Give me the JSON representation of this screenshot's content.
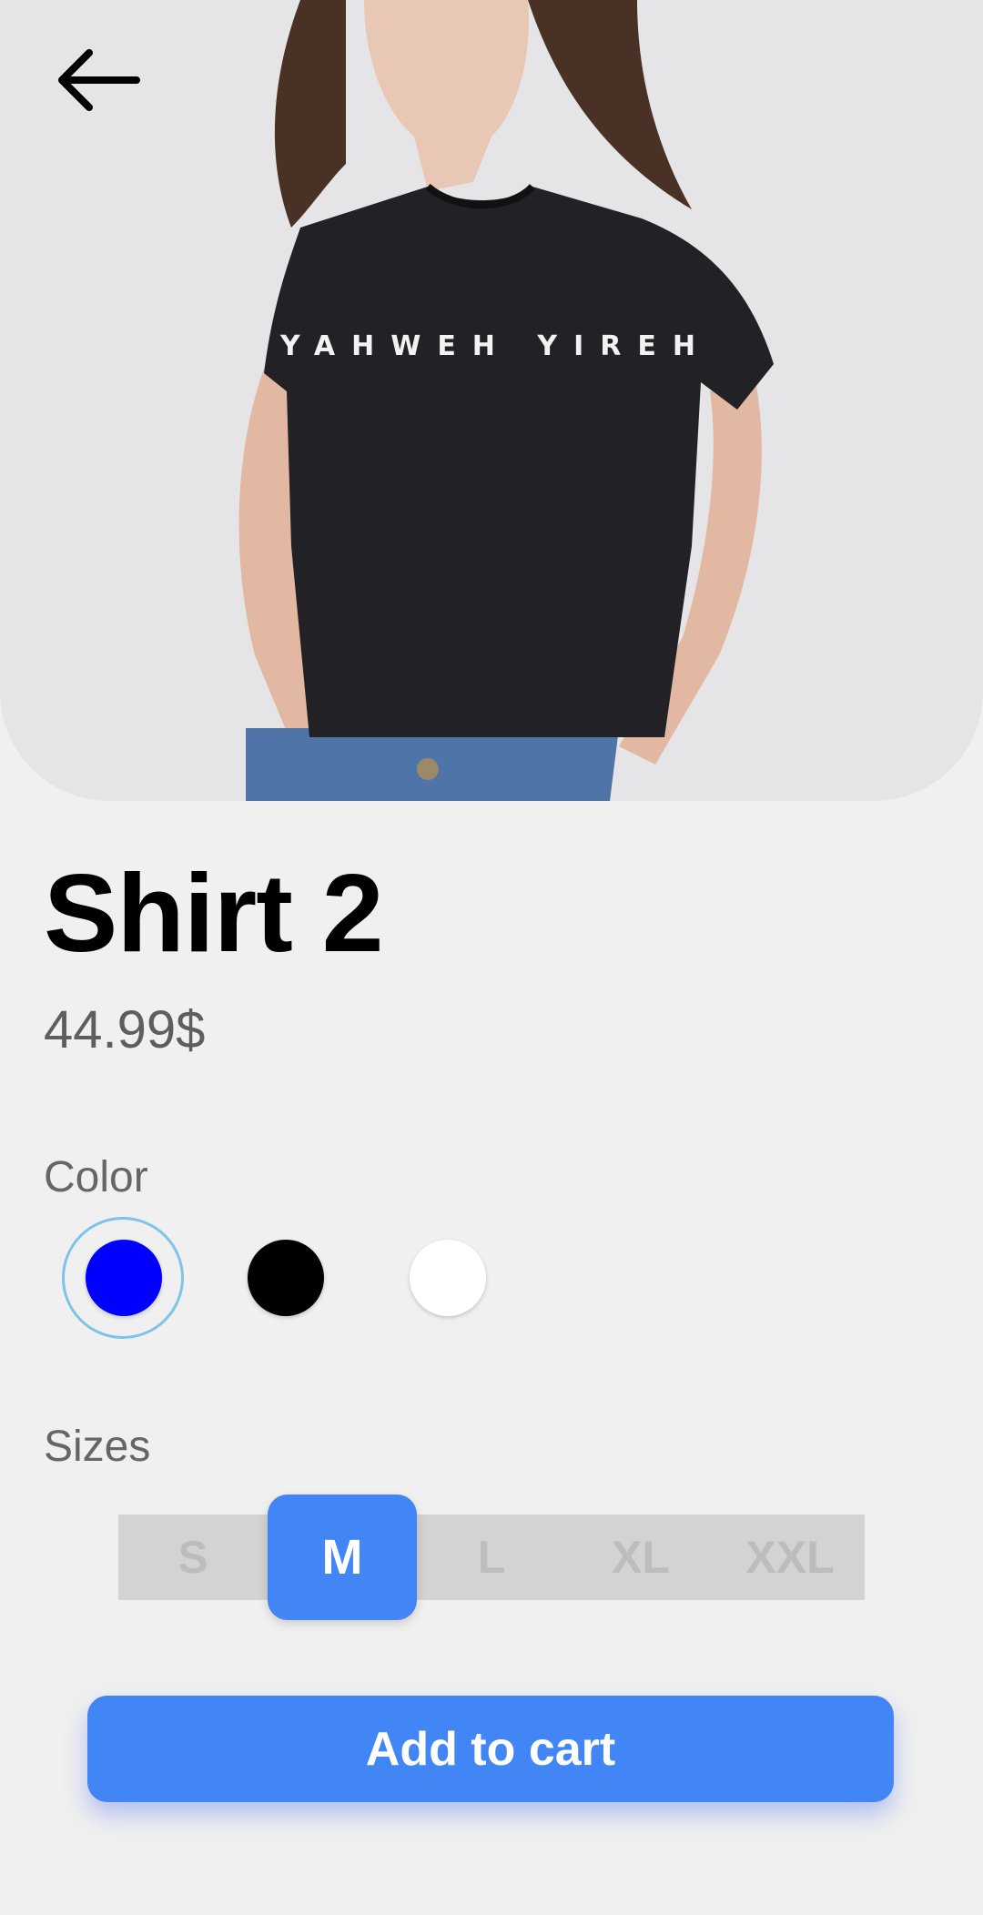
{
  "product": {
    "name": "Shirt 2",
    "price": "44.99$",
    "image_print": "YAHWEH YIREH"
  },
  "color_section": {
    "label": "Color",
    "swatches": [
      {
        "name": "blue",
        "hex": "#0000ff",
        "selected": true
      },
      {
        "name": "black",
        "hex": "#000000",
        "selected": false
      },
      {
        "name": "white",
        "hex": "#ffffff",
        "selected": false
      }
    ]
  },
  "sizes_section": {
    "label": "Sizes",
    "options": [
      "S",
      "M",
      "L",
      "XL",
      "XXL"
    ],
    "selected": "M"
  },
  "cart": {
    "button_label": "Add to cart"
  },
  "theme": {
    "accent": "#4285f4",
    "background": "#f0f0f0",
    "selected_ring": "#7ec4e8"
  },
  "icons": {
    "back": "arrow-left-icon"
  }
}
